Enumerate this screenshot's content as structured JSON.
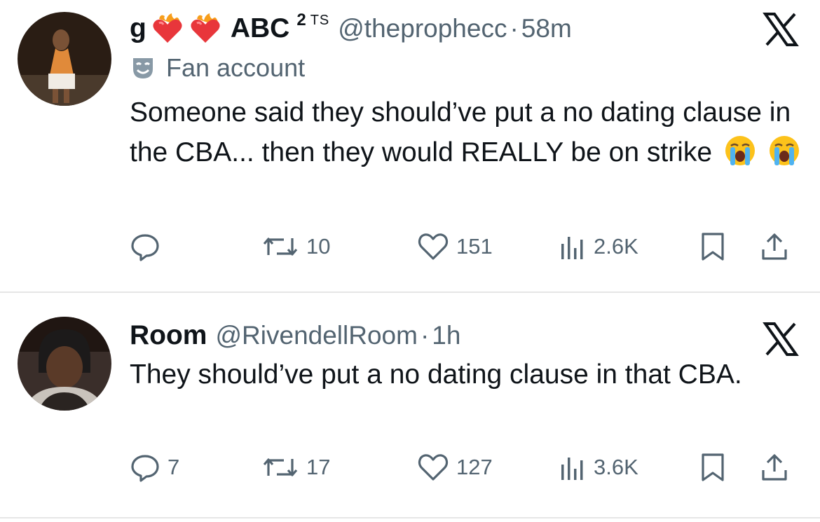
{
  "tweets": [
    {
      "name": "g",
      "name_suffix": "ABC",
      "sup": "2",
      "ts_mark": "TS",
      "handle": "@theprophecc",
      "separator": "·",
      "time": "58m",
      "label": "Fan account",
      "text": "Someone said they should’ve put a no dating clause in the CBA... then they would REALLY be on strike",
      "reply_count": "",
      "retweet_count": "10",
      "like_count": "151",
      "view_count": "2.6K"
    },
    {
      "name": "Room",
      "handle": "@RivendellRoom",
      "separator": "·",
      "time": "1h",
      "text": "They should’ve put a no dating clause in that CBA.",
      "reply_count": "7",
      "retweet_count": "17",
      "like_count": "127",
      "view_count": "3.6K"
    }
  ],
  "icons": {
    "close": "x-logo-icon",
    "heart_fire": "heart-on-fire-icon",
    "fan": "theater-mask-icon",
    "cry": "loudly-crying-face-icon",
    "reply": "reply-icon",
    "retweet": "retweet-icon",
    "like": "heart-icon",
    "views": "views-chart-icon",
    "bookmark": "bookmark-icon",
    "share": "share-icon"
  },
  "colors": {
    "text": "#0f1419",
    "secondary": "#536471",
    "divider": "#e6e6e6"
  }
}
